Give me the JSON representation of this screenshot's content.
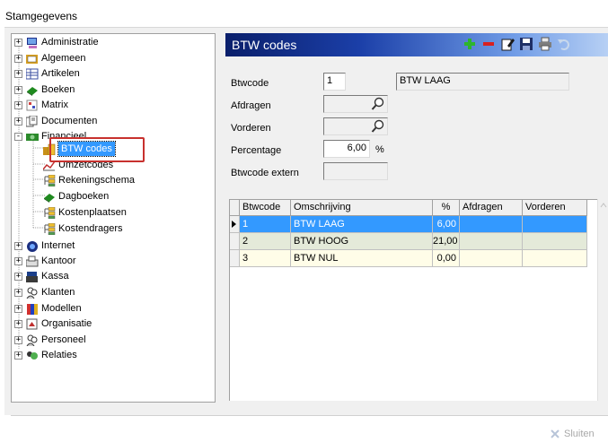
{
  "window": {
    "title": "Stamgegevens"
  },
  "tree": {
    "items": [
      {
        "label": "Administratie",
        "icon": "computer-icon",
        "expander": "+",
        "level": 0
      },
      {
        "label": "Algemeen",
        "icon": "folder-card-icon",
        "expander": "+",
        "level": 0
      },
      {
        "label": "Artikelen",
        "icon": "grid-icon",
        "expander": "+",
        "level": 0
      },
      {
        "label": "Boeken",
        "icon": "book-icon",
        "expander": "+",
        "level": 0
      },
      {
        "label": "Matrix",
        "icon": "matrix-icon",
        "expander": "+",
        "level": 0
      },
      {
        "label": "Documenten",
        "icon": "documents-icon",
        "expander": "+",
        "level": 0
      },
      {
        "label": "Financieel",
        "icon": "money-icon",
        "expander": "-",
        "level": 0
      },
      {
        "label": "BTW codes",
        "icon": "coins-icon",
        "level": 1,
        "selected": true
      },
      {
        "label": "Umzetcodes",
        "icon": "chart-icon",
        "level": 1
      },
      {
        "label": "Rekeningschema",
        "icon": "schema-icon",
        "level": 1
      },
      {
        "label": "Dagboeken",
        "icon": "book-icon",
        "level": 1
      },
      {
        "label": "Kostenplaatsen",
        "icon": "schema-icon",
        "level": 1
      },
      {
        "label": "Kostendragers",
        "icon": "schema-icon",
        "level": 1
      },
      {
        "label": "Internet",
        "icon": "globe-icon",
        "expander": "+",
        "level": 0
      },
      {
        "label": "Kantoor",
        "icon": "office-icon",
        "expander": "+",
        "level": 0
      },
      {
        "label": "Kassa",
        "icon": "register-icon",
        "expander": "+",
        "level": 0
      },
      {
        "label": "Klanten",
        "icon": "people-icon",
        "expander": "+",
        "level": 0
      },
      {
        "label": "Modellen",
        "icon": "models-icon",
        "expander": "+",
        "level": 0
      },
      {
        "label": "Organisatie",
        "icon": "organisation-icon",
        "expander": "+",
        "level": 0
      },
      {
        "label": "Personeel",
        "icon": "people-icon",
        "expander": "+",
        "level": 0
      },
      {
        "label": "Relaties",
        "icon": "relations-icon",
        "expander": "+",
        "level": 0
      }
    ]
  },
  "panel": {
    "title": "BTW codes",
    "toolbar": [
      "add-icon",
      "delete-icon",
      "edit-icon",
      "save-icon",
      "print-icon",
      "undo-icon"
    ]
  },
  "form": {
    "btwcode_label": "Btwcode",
    "btwcode_value": "1",
    "btwcode_desc": "BTW LAAG",
    "afdragen_label": "Afdragen",
    "afdragen_value": "",
    "vorderen_label": "Vorderen",
    "vorderen_value": "",
    "percentage_label": "Percentage",
    "percentage_value": "6,00",
    "percentage_unit": "%",
    "extern_label": "Btwcode extern",
    "extern_value": ""
  },
  "grid": {
    "columns": [
      "Btwcode",
      "Omschrijving",
      "%",
      "Afdragen",
      "Vorderen"
    ],
    "rows": [
      {
        "code": "1",
        "desc": "BTW LAAG",
        "pct": "6,00",
        "afdragen": "",
        "vorderen": "",
        "selected": true
      },
      {
        "code": "2",
        "desc": "BTW HOOG",
        "pct": "21,00",
        "afdragen": "",
        "vorderen": ""
      },
      {
        "code": "3",
        "desc": "BTW NUL",
        "pct": "0,00",
        "afdragen": "",
        "vorderen": ""
      }
    ]
  },
  "footer": {
    "close_label": "Sluiten"
  },
  "colors": {
    "selection": "#3399ff",
    "row_selected": "#3399ff",
    "row_odd": "#fffde8",
    "row_even": "#e4ead9",
    "highlight_box": "#c8312e"
  }
}
